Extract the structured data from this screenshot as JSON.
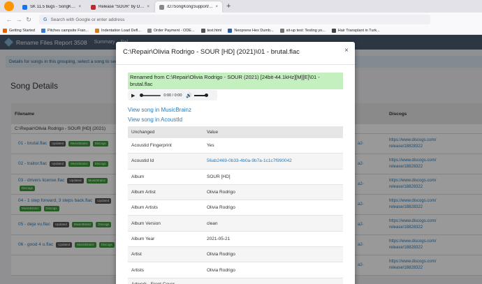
{
  "browser": {
    "tabs": [
      {
        "label": "SK 11.5 bugs - SongKong Musi",
        "color": "#1a73e8"
      },
      {
        "label": "Release “SOUR” by Olivia Rodri",
        "color": "#ba2b2b"
      },
      {
        "label": "/D:/SongKongSupport/daren.p",
        "color": "#888888",
        "active": true
      }
    ],
    "new_tab": "+",
    "url_placeholder": "Search with Google or enter address",
    "bookmarks": [
      "Getting Started",
      "Pitches campsite Fran...",
      "Indentation Load Defl...",
      "Order Payment - ODE...",
      "text.html",
      "Neoprene Hex Dumb...",
      "sit-up test: Testing yo...",
      "Hair Transplant in Turk..."
    ]
  },
  "app": {
    "title": "Rename Files Report 3508",
    "nav": [
      "Summary",
      "Rel"
    ]
  },
  "page": {
    "info": "Details for songs in this grouping, select a song to see",
    "section_title": "Song Details",
    "columns": {
      "filename": "Filename",
      "discogs": "Discogs"
    },
    "group": "C:\\Repair\\Olivia Rodrigo - SOUR [HD] (2021)",
    "rows": [
      {
        "file": "01 - brutal.flac",
        "badges": [
          "Updated",
          "MusicBrainz",
          "Discogs"
        ],
        "mid": "a2-",
        "discogs": [
          "https://www.discogs.com/",
          "release/18828322"
        ]
      },
      {
        "file": "02 - traitor.flac",
        "badges": [
          "Updated",
          "MusicBrainz",
          "Discogs"
        ],
        "mid": "a2-",
        "discogs": [
          "https://www.discogs.com/",
          "release/18828322"
        ]
      },
      {
        "file": "03 - drivers license.flac",
        "badges": [
          "Updated",
          "MusicBrainz",
          "Discogs"
        ],
        "mid": "a2-",
        "discogs": [
          "https://www.discogs.com/",
          "release/18828322"
        ]
      },
      {
        "file": "04 - 1 step forward, 3 steps back.flac",
        "badges": [
          "Updated",
          "MusicBrainz",
          "Discogs"
        ],
        "mid": "a2-",
        "discogs": [
          "https://www.discogs.com/",
          "release/18828322"
        ]
      },
      {
        "file": "05 - deja vu.flac",
        "badges": [
          "Updated",
          "MusicBrainz",
          "Discogs"
        ],
        "mid": "a2-",
        "discogs": [
          "https://www.discogs.com/",
          "release/18828322"
        ]
      },
      {
        "file": "06 - good 4 u.flac",
        "badges": [
          "Updated",
          "MusicBrainz",
          "Discogs"
        ],
        "mid": "a2-",
        "discogs": [
          "https://www.discogs.com/",
          "release/18828322"
        ]
      },
      {
        "file": "",
        "badges": [],
        "mid": "a2-",
        "discogs": [
          "https://www.discogs.com/",
          "release/18828322"
        ]
      }
    ]
  },
  "modal": {
    "title": "C:\\Repair\\Olivia Rodrigo - SOUR [HD] (2021)\\01 - brutal.flac",
    "close": "×",
    "renamed_from": "Renamed from C:\\Repair\\Olivia Rodrigo - SOUR (2021) [24bit-44.1kHz][M][E]\\01 - brutal.flac",
    "audio_time": "0:00 / 0:00",
    "link_musicbrainz": "View song in MusicBrainz",
    "link_acoustid": "View song in AcoustId",
    "table_headers": {
      "field": "Unchanged",
      "value": "Value"
    },
    "fields": [
      {
        "key": "Acoustid Fingerprint",
        "value": "Yes"
      },
      {
        "key": "Acoustid Id",
        "value": "56ab2469-0b33-4b0a-9b7a-1c1c7f990042",
        "link": true
      },
      {
        "key": "Album",
        "value": "SOUR [HD]"
      },
      {
        "key": "Album Artist",
        "value": "Olivia Rodrigo"
      },
      {
        "key": "Album Artists",
        "value": "Olivia Rodrigo"
      },
      {
        "key": "Album Version",
        "value": "clean"
      },
      {
        "key": "Album Year",
        "value": "2021-05-21"
      },
      {
        "key": "Artist",
        "value": "Olivia Rodrigo"
      },
      {
        "key": "Artists",
        "value": "Olivia Rodrigo"
      },
      {
        "key": "Artwork - Front Cover",
        "value": ""
      }
    ]
  }
}
